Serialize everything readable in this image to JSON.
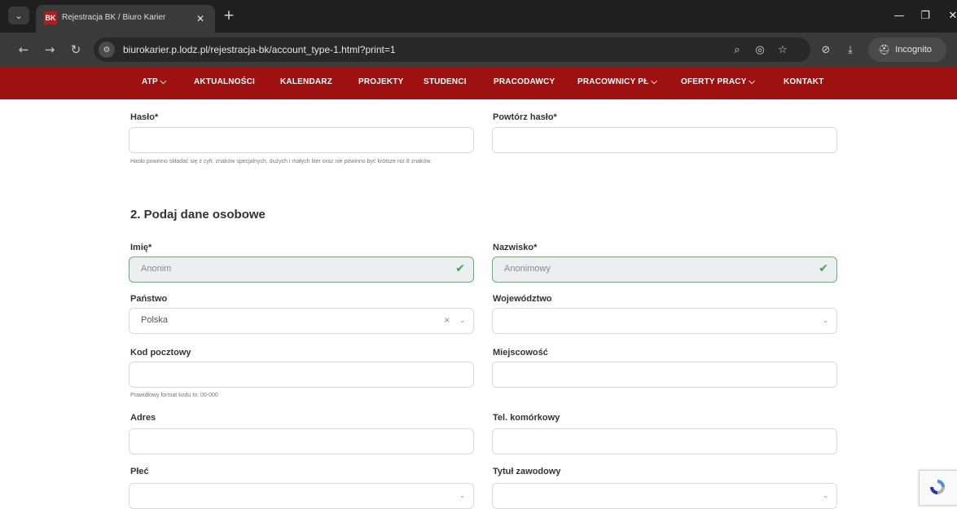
{
  "browser": {
    "tab_title": "Rejestracja BK / Biuro Karier",
    "favicon_text": "BK",
    "url": "biurokarier.p.lodz.pl/rejestracja-bk/account_type-1.html?print=1",
    "incognito_label": "Incognito",
    "new_tab_symbol": "+",
    "tab_close_symbol": "✕"
  },
  "nav": {
    "items": [
      "ATP ⌵",
      "AKTUALNOŚCI",
      "KALENDARZ",
      "PROJEKTY",
      "STUDENCI",
      "PRACODAWCY",
      "PRACOWNICY PŁ ⌵",
      "OFERTY PRACY ⌵",
      "KONTAKT"
    ]
  },
  "form": {
    "password_label": "Hasło*",
    "password_repeat_label": "Powtórz hasło*",
    "password_hint": "Hasło powinno składać się z cyfr, znaków specjalnych, dużych i małych liter oraz nie powinno być krótsze niż 8 znaków.",
    "section_title": "2. Podaj dane osobowe",
    "first_name_label": "Imię*",
    "first_name_value": "Anonim",
    "last_name_label": "Nazwisko*",
    "last_name_value": "Anonimowy",
    "country_label": "Państwo",
    "country_value": "Polska",
    "province_label": "Województwo",
    "postal_code_label": "Kod pocztowy",
    "postal_code_hint": "Prawidłowy format kodu to: 00-000",
    "city_label": "Miejscowość",
    "address_label": "Adres",
    "mobile_label": "Tel. komórkowy",
    "gender_label": "Płeć",
    "title_label": "Tytuł zawodowy"
  },
  "colors": {
    "nav_background": "#9e1111",
    "valid_border": "#54b96a",
    "check_color": "#34a853"
  },
  "icons": {
    "check": "✔",
    "clear": "×",
    "caret": "⌄"
  }
}
